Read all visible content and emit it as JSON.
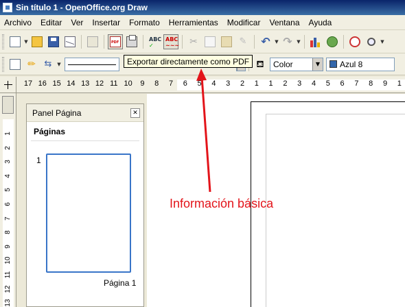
{
  "window": {
    "title": "Sin título 1 - OpenOffice.org Draw"
  },
  "menu": [
    "Archivo",
    "Editar",
    "Ver",
    "Insertar",
    "Formato",
    "Herramientas",
    "Modificar",
    "Ventana",
    "Ayuda"
  ],
  "toolbar2": {
    "area_style": "Color",
    "area_color": "Azul 8",
    "swatch_color": "#3366aa"
  },
  "tooltip": "Exportar directamente como PDF",
  "ruler_h": [
    "17",
    "16",
    "15",
    "14",
    "13",
    "12",
    "11",
    "10",
    "9",
    "8",
    "7",
    "6",
    "5",
    "4",
    "3",
    "2",
    "1",
    "1",
    "2",
    "3",
    "4",
    "5",
    "6",
    "7",
    "8",
    "9",
    "1"
  ],
  "ruler_v": [
    "1",
    "2",
    "3",
    "4",
    "5",
    "6",
    "7",
    "8",
    "9",
    "10",
    "11",
    "12",
    "13"
  ],
  "panel": {
    "title": "Panel Página",
    "section": "Páginas",
    "page_number": "1",
    "page_label": "Página 1"
  },
  "annotation": {
    "text": "Información básica",
    "color": "#e3141a"
  }
}
